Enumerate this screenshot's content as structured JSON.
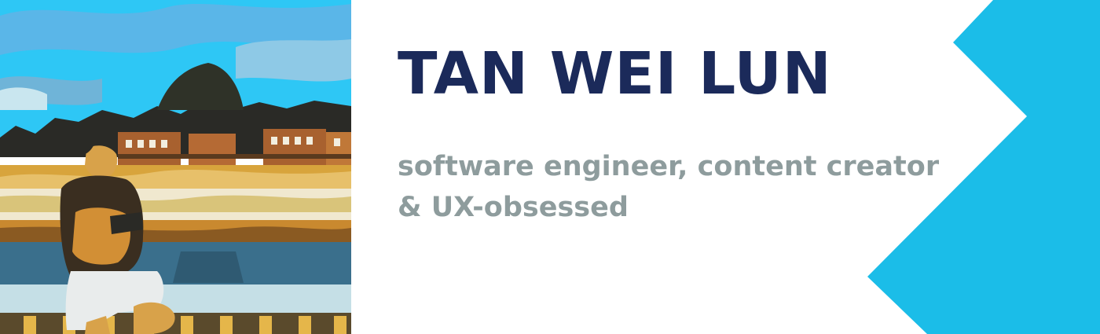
{
  "profile": {
    "name": "TAN WEI LUN",
    "tagline": "software engineer, content creator & UX-obsessed"
  },
  "photo": {
    "alt": "Posterized photo of a man sitting on a ledge by a field, with trees, buildings and a blue sky behind him"
  },
  "colors": {
    "name": "#1b2a5a",
    "tagline": "#8e9c9d",
    "accent": "#1bbde8",
    "background": "#ffffff"
  }
}
